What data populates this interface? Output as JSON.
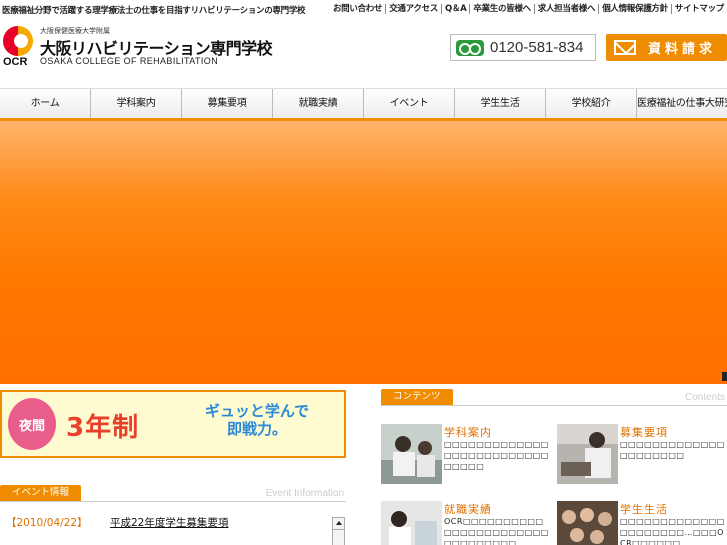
{
  "top": {
    "tagline": "医療福祉分野で活躍する理学療法士の仕事を目指すリハビリテーションの専門学校",
    "links": [
      "お問い合わせ",
      "交通アクセス",
      "Q＆A",
      "卒業生の皆様へ",
      "求人担当者様へ",
      "個人情報保護方針",
      "サイトマップ"
    ]
  },
  "logo": {
    "mark": "OCR",
    "sub": "大阪保健医療大学附属",
    "name": "大阪リハビリテーション専門学校",
    "english": "OSAKA COLLEGE OF REHABILITATION"
  },
  "contact": {
    "phone": "0120-581-834",
    "request_label": "資料請求"
  },
  "nav": [
    "ホーム",
    "学科案内",
    "募集要項",
    "就職実績",
    "イベント",
    "学生生活",
    "学校紹介",
    "医療福祉の仕事大研究"
  ],
  "banner": {
    "badge": "夜間",
    "years": "3年制",
    "slogan_line1": "ギュッと学んで",
    "slogan_line2": "即戦力。"
  },
  "events": {
    "heading": "イベント情報",
    "heading_en": "Event Information",
    "items": [
      {
        "date": "【2010/04/22】",
        "title": "平成22年度学生募集要項"
      }
    ]
  },
  "contents": {
    "heading": "コンテンツ",
    "heading_en": "Contents",
    "items": [
      {
        "title": "学科案内",
        "desc": "□□□□□□□□□□□□□□□□□□□□□□□□□□□□□□□"
      },
      {
        "title": "募集要項",
        "desc": "□□□□□□□□□□□□□□□□□□□□□"
      },
      {
        "title": "就職実績",
        "desc": "OCR□□□□□□□□□□□□□□□□□□□□□□□□□□□□□□□□"
      },
      {
        "title": "学生生活",
        "desc": "□□□□□□□□□□□□□□□□□□□□□…□□□OCR□□□□□□"
      }
    ]
  },
  "colors": {
    "accent": "#f08c00",
    "hero_top": "#ffb36b",
    "hero_bottom": "#ff6f00",
    "phone_icon": "#2a9a3a"
  }
}
